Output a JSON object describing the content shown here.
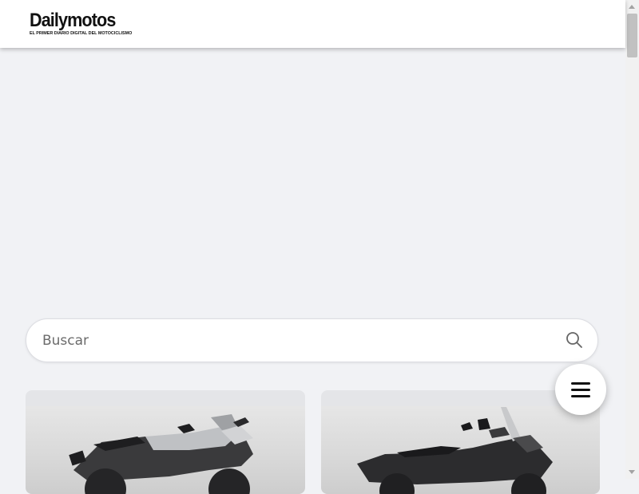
{
  "header": {
    "logo_name": "Dailymotos",
    "logo_tagline": "EL PRIMER DIARIO DIGITAL DEL MOTOCICLISMO"
  },
  "search": {
    "placeholder": "Buscar",
    "icon": "search-icon"
  },
  "menu_button": {
    "icon": "hamburger-menu-icon"
  },
  "cards": [
    {
      "image": "sport-motorcycle-photo"
    },
    {
      "image": "maxi-scooter-photo"
    }
  ],
  "colors": {
    "page_background": "#f1f2f5",
    "header_background": "#ffffff",
    "text": "#111111"
  }
}
